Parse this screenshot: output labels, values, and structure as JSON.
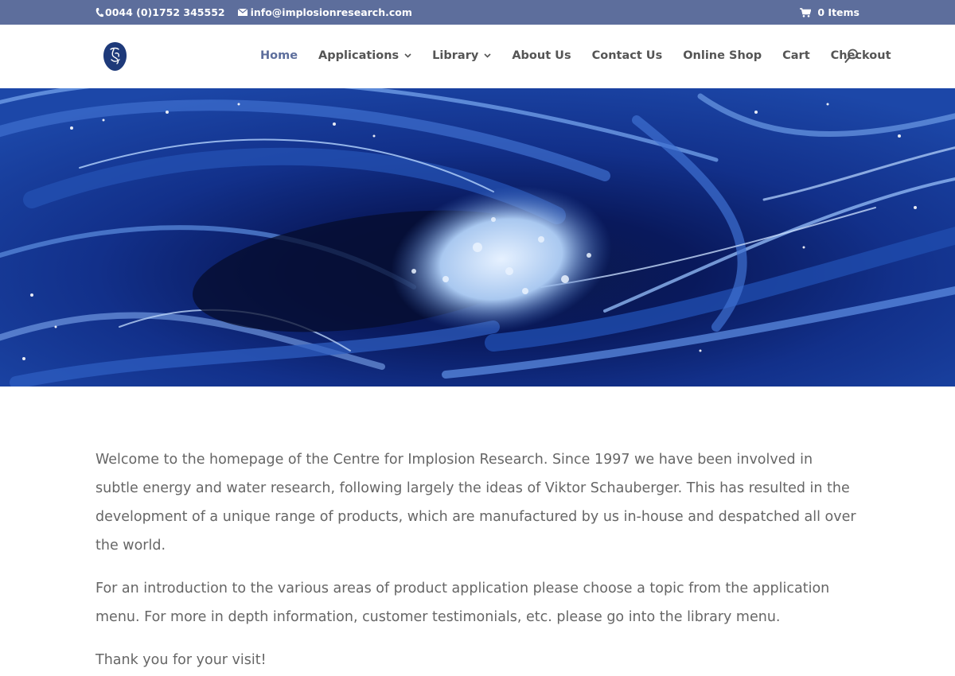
{
  "topbar": {
    "phone": "0044 (0)1752 345552",
    "email": "info@implosionresearch.com",
    "cart_label": "0 Items",
    "phone_icon": "phone-icon",
    "email_icon": "mail-icon",
    "cart_icon": "cart-icon"
  },
  "header": {
    "logo_icon": "logo-icon",
    "nav": [
      {
        "label": "Home",
        "active": true
      },
      {
        "label": "Applications",
        "dropdown": true
      },
      {
        "label": "Library",
        "dropdown": true
      },
      {
        "label": "About Us"
      },
      {
        "label": "Contact Us"
      },
      {
        "label": "Online Shop"
      },
      {
        "label": "Cart"
      },
      {
        "label": "Checkout"
      }
    ],
    "search_icon": "search-icon"
  },
  "hero": {
    "image": "water-vortex"
  },
  "content": {
    "paragraphs": [
      "Welcome to the homepage of the Centre for Implosion Research. Since 1997 we have been involved in subtle energy and water research, following largely the ideas of Viktor Schauberger. This has resulted in the development of a unique range of products, which are manufactured by us in-house and despatched all over the world.",
      "For an introduction to the various areas of product application please choose a topic from the application menu. For more in depth information, customer testimonials, etc. please go into the library menu.",
      "Thank you for your visit!"
    ]
  },
  "colors": {
    "topbar_bg": "#5d6e9c",
    "nav_active": "#5d6e9c",
    "nav_text": "#555555",
    "body_text": "#666666",
    "logo": "#1e3a7a"
  }
}
